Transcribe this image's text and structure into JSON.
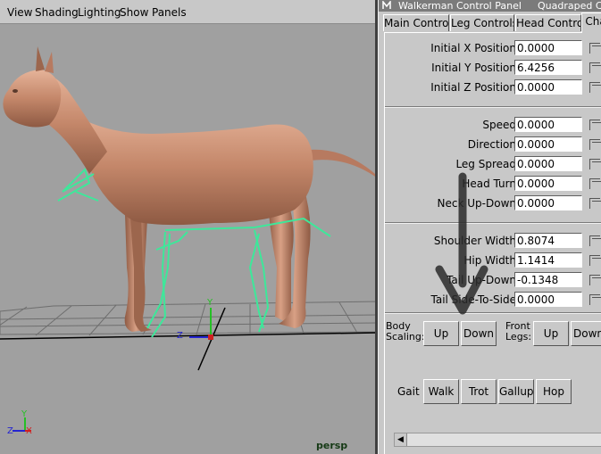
{
  "viewport": {
    "menu": [
      "View",
      "Shading",
      "Lighting",
      "Show",
      "Panels"
    ],
    "camera_label": "persp",
    "axis_labels": {
      "y": "Y",
      "z": "Z",
      "x": "X"
    }
  },
  "panel": {
    "title": "Walkerman Control Panel",
    "subtitle": "Quadraped C",
    "tabs": [
      "Main Controls",
      "Leg Controls",
      "Head Control",
      "Cha"
    ],
    "active_tab": "Cha",
    "position_fields": [
      {
        "label": "Initial X Position",
        "value": "0.0000"
      },
      {
        "label": "Initial Y Position",
        "value": "6.4256"
      },
      {
        "label": "Initial Z Position",
        "value": "0.0000"
      }
    ],
    "motion_fields": [
      {
        "label": "Speed",
        "value": "0.0000"
      },
      {
        "label": "Direction",
        "value": "0.0000"
      },
      {
        "label": "Leg Spread",
        "value": "0.0000"
      },
      {
        "label": "Head Turn",
        "value": "0.0000"
      },
      {
        "label": "Neck Up-Down",
        "value": "0.0000"
      }
    ],
    "body_fields": [
      {
        "label": "Shoulder Width",
        "value": "0.8074"
      },
      {
        "label": "Hip Width",
        "value": "1.1414"
      },
      {
        "label": "Tail Up-Down",
        "value": "-0.1348"
      },
      {
        "label": "Tail Side-To-Side",
        "value": "0.0000"
      }
    ],
    "body_scaling": {
      "label_line1": "Body",
      "label_line2": "Scaling:",
      "up": "Up",
      "down": "Down"
    },
    "front_legs": {
      "label_line1": "Front",
      "label_line2": "Legs:",
      "up": "Up",
      "down": "Down"
    },
    "gait": {
      "label": "Gait",
      "buttons": [
        "Walk",
        "Trot",
        "Gallup",
        "Hop"
      ]
    }
  },
  "colors": {
    "viewport_bg": "#a0a0a0",
    "horse": "#c4876a",
    "skeleton": "#3de89a",
    "grid": "#6e6e6e",
    "panel_bg": "#c8c8c8"
  }
}
